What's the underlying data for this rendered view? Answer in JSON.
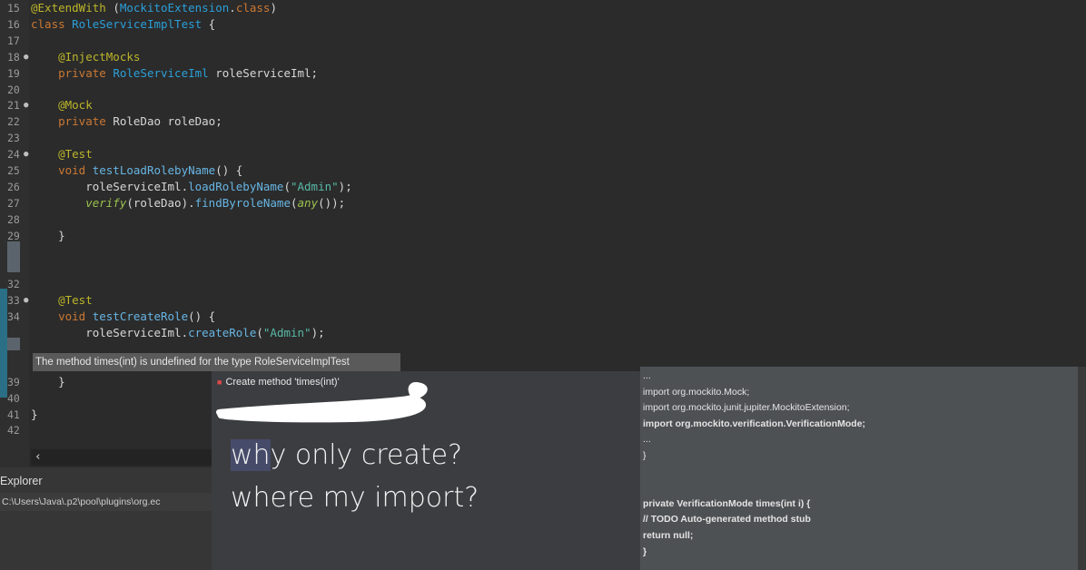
{
  "editor": {
    "lines": [
      {
        "n": "15",
        "fold": "",
        "segs": [
          {
            "c": "an",
            "t": "@ExtendWith"
          },
          {
            "c": "sym",
            "t": " ("
          },
          {
            "c": "ty",
            "t": "MockitoExtension"
          },
          {
            "c": "sym",
            "t": "."
          },
          {
            "c": "kw",
            "t": "class"
          },
          {
            "c": "sym",
            "t": ")"
          }
        ]
      },
      {
        "n": "16",
        "fold": "",
        "segs": [
          {
            "c": "kw",
            "t": "class "
          },
          {
            "c": "ty",
            "t": "RoleServiceImplTest"
          },
          {
            "c": "sym",
            "t": " {"
          }
        ]
      },
      {
        "n": "17",
        "fold": "",
        "segs": []
      },
      {
        "n": "18",
        "fold": "●",
        "segs": [
          {
            "c": "an",
            "t": "    @InjectMocks"
          }
        ]
      },
      {
        "n": "19",
        "fold": "",
        "segs": [
          {
            "c": "kw",
            "t": "    private "
          },
          {
            "c": "ty",
            "t": "RoleServiceIml"
          },
          {
            "c": "id",
            "t": " roleServiceIml;"
          }
        ]
      },
      {
        "n": "20",
        "fold": "",
        "segs": []
      },
      {
        "n": "21",
        "fold": "●",
        "segs": [
          {
            "c": "an",
            "t": "    @Mock"
          }
        ]
      },
      {
        "n": "22",
        "fold": "",
        "segs": [
          {
            "c": "kw",
            "t": "    private "
          },
          {
            "c": "id",
            "t": "RoleDao roleDao;"
          }
        ]
      },
      {
        "n": "23",
        "fold": "",
        "segs": []
      },
      {
        "n": "24",
        "fold": "●",
        "segs": [
          {
            "c": "an",
            "t": "    @Test"
          }
        ]
      },
      {
        "n": "25",
        "fold": "",
        "segs": [
          {
            "c": "kw",
            "t": "    void "
          },
          {
            "c": "fn",
            "t": "testLoadRolebyName"
          },
          {
            "c": "sym",
            "t": "() {"
          }
        ]
      },
      {
        "n": "26",
        "fold": "",
        "segs": [
          {
            "c": "id",
            "t": "        roleServiceIml."
          },
          {
            "c": "fn",
            "t": "loadRolebyName"
          },
          {
            "c": "sym",
            "t": "("
          },
          {
            "c": "str",
            "t": "\"Admin\""
          },
          {
            "c": "sym",
            "t": ");"
          }
        ]
      },
      {
        "n": "27",
        "fold": "",
        "segs": [
          {
            "c": "it",
            "t": "        verify"
          },
          {
            "c": "id",
            "t": "(roleDao)."
          },
          {
            "c": "fn",
            "t": "findByroleName"
          },
          {
            "c": "sym",
            "t": "("
          },
          {
            "c": "it",
            "t": "any"
          },
          {
            "c": "sym",
            "t": "());"
          }
        ]
      },
      {
        "n": "28",
        "fold": "",
        "segs": []
      },
      {
        "n": "29",
        "fold": "",
        "segs": [
          {
            "c": "sym",
            "t": "    }"
          }
        ]
      },
      {
        "n": "",
        "fold": "",
        "segs": []
      },
      {
        "n": "",
        "fold": "",
        "segs": []
      },
      {
        "n": "32",
        "fold": "",
        "segs": []
      },
      {
        "n": "33",
        "fold": "●",
        "segs": [
          {
            "c": "an",
            "t": "    @Test"
          }
        ]
      },
      {
        "n": "34",
        "fold": "",
        "segs": [
          {
            "c": "kw",
            "t": "    void "
          },
          {
            "c": "fn",
            "t": "testCreateRole"
          },
          {
            "c": "sym",
            "t": "() {"
          }
        ]
      },
      {
        "n": "",
        "fold": "",
        "segs": [
          {
            "c": "id",
            "t": "        roleServiceIml."
          },
          {
            "c": "fn",
            "t": "createRole"
          },
          {
            "c": "sym",
            "t": "("
          },
          {
            "c": "str",
            "t": "\"Admin\""
          },
          {
            "c": "sym",
            "t": ");"
          }
        ]
      },
      {
        "n": "",
        "fold": "",
        "segs": []
      },
      {
        "n": "",
        "fold": "",
        "segs": []
      },
      {
        "n": "39",
        "fold": "",
        "segs": [
          {
            "c": "sym",
            "t": "    }"
          }
        ]
      },
      {
        "n": "40",
        "fold": "",
        "segs": []
      },
      {
        "n": "41",
        "fold": "",
        "segs": [
          {
            "c": "sym",
            "t": "}"
          }
        ]
      },
      {
        "n": "42",
        "fold": "",
        "segs": []
      }
    ],
    "hscroll_arrow": "‹"
  },
  "tooltip": {
    "text": "The method times(int) is undefined for the type RoleServiceImplTest"
  },
  "quickfix": {
    "item": "Create method 'times(int)'",
    "icon": "error-dot-icon"
  },
  "annotation": {
    "line1_hl": "wh",
    "line1_rest": "y only create?",
    "line2": "where my import?"
  },
  "preview": {
    "lines": [
      {
        "t": "...",
        "b": false
      },
      {
        "t": "import org.mockito.Mock;",
        "b": false
      },
      {
        "t": "import org.mockito.junit.jupiter.MockitoExtension;",
        "b": false
      },
      {
        "t": "import org.mockito.verification.VerificationMode;",
        "b": true
      },
      {
        "t": "...",
        "b": false
      },
      {
        "t": "}",
        "b": false
      },
      {
        "t": "",
        "b": false
      },
      {
        "t": "",
        "b": false
      },
      {
        "t": "private VerificationMode times(int i) {",
        "b": true
      },
      {
        "t": "// TODO Auto-generated method stub",
        "b": true
      },
      {
        "t": "return null;",
        "b": true
      },
      {
        "t": "}",
        "b": true
      }
    ]
  },
  "bottom_panel": {
    "tab": "Explorer",
    "path": "C:\\Users\\Java\\.p2\\pool\\plugins\\org.ec"
  },
  "colors": {
    "editor_bg": "#2b2b2b",
    "keyword": "#cc7832",
    "annotation": "#bbb529",
    "type": "#2b9fd9",
    "string": "#58b9a6"
  }
}
